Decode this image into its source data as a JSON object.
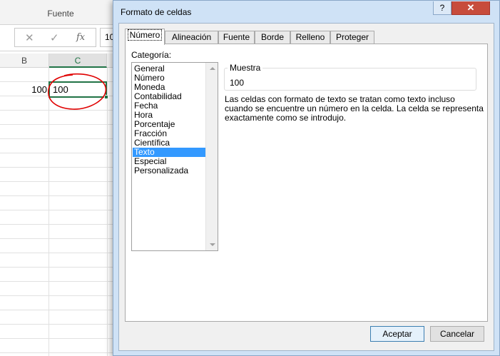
{
  "excel": {
    "ribbon_group": "Fuente",
    "formula_bar": {
      "cancel_icon": "✕",
      "enter_icon": "✓",
      "fx_icon": "fx",
      "value": "10"
    },
    "columns": [
      "B",
      "C"
    ],
    "cell_b": "100",
    "cell_c": "100"
  },
  "dialog": {
    "title": "Formato de celdas",
    "help": "?",
    "close": "✕",
    "tabs": [
      "Número",
      "Alineación",
      "Fuente",
      "Borde",
      "Relleno",
      "Proteger"
    ],
    "active_tab": "Número",
    "category_label": "Categoría:",
    "categories": [
      "General",
      "Número",
      "Moneda",
      "Contabilidad",
      "Fecha",
      "Hora",
      "Porcentaje",
      "Fracción",
      "Científica",
      "Texto",
      "Especial",
      "Personalizada"
    ],
    "selected_category": "Texto",
    "sample_label": "Muestra",
    "sample_value": "100",
    "description": "Las celdas con formato de texto se tratan como texto incluso cuando se encuentre un número en la celda. La celda se representa exactamente como se introdujo.",
    "accept": "Aceptar",
    "cancel": "Cancelar"
  },
  "colors": {
    "excel_green": "#217346",
    "selection_blue": "#3399ff",
    "annotation_red": "#e00000",
    "close_red": "#c74c3c"
  }
}
